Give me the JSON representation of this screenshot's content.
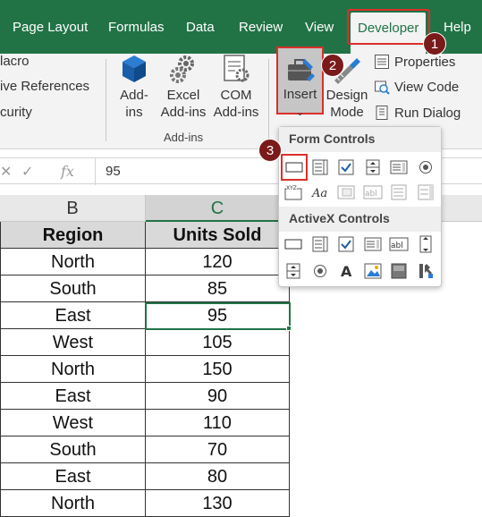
{
  "tabs": [
    "Page Layout",
    "Formulas",
    "Data",
    "Review",
    "View",
    "Developer",
    "Help"
  ],
  "active_tab": "Developer",
  "ribbon": {
    "code_items": [
      "lacro",
      "ive References",
      "curity"
    ],
    "addins": {
      "addins_label_1": "Add-",
      "addins_label_2": "ins",
      "excel_label_1": "Excel",
      "excel_label_2": "Add-ins",
      "com_label_1": "COM",
      "com_label_2": "Add-ins",
      "group_label": "Add-ins"
    },
    "insert_label": "Insert",
    "design_label_1": "Design",
    "design_label_2": "Mode",
    "properties_label": "Properties",
    "view_code_label": "View Code",
    "run_dialog_label": "Run Dialog"
  },
  "dropdown": {
    "form_controls_title": "Form Controls",
    "activex_controls_title": "ActiveX Controls"
  },
  "formula_bar": {
    "value": "95",
    "fx": "fx"
  },
  "columns": [
    "B",
    "C"
  ],
  "table": {
    "headers": [
      "Region",
      "Units Sold"
    ],
    "rows": [
      [
        "North",
        "120"
      ],
      [
        "South",
        "85"
      ],
      [
        "East",
        "95"
      ],
      [
        "West",
        "105"
      ],
      [
        "North",
        "150"
      ],
      [
        "East",
        "90"
      ],
      [
        "West",
        "110"
      ],
      [
        "South",
        "70"
      ],
      [
        "East",
        "80"
      ],
      [
        "North",
        "130"
      ]
    ]
  },
  "callouts": [
    "1",
    "2",
    "3"
  ],
  "colors": {
    "excel_green": "#217346",
    "highlight_red": "#d9302a",
    "badge": "#7a1a1a"
  }
}
